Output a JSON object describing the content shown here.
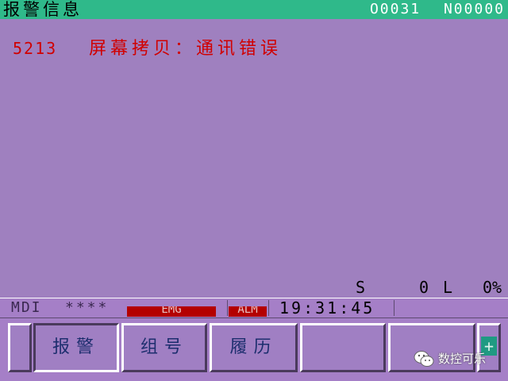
{
  "header": {
    "title": "报警信息",
    "program": "O0031",
    "sequence": "N00000"
  },
  "alarm": {
    "code": "5213",
    "message": "屏幕拷贝：通讯错误"
  },
  "spindle": {
    "s_label": "S",
    "s_value": "0",
    "l_label": "L",
    "l_value": "0%"
  },
  "status": {
    "mode": "MDI",
    "stars": "****",
    "emg": "EMG",
    "alm": "ALM",
    "time": "19:31:45"
  },
  "softkeys": {
    "k1": "报警",
    "k2": "组号",
    "k3": "履历",
    "k4": "",
    "k5": ""
  },
  "plus": "+",
  "watermark": "数控可乐",
  "colors": {
    "background": "#9f80bf",
    "header": "#2fb98a",
    "alarm_text": "#d00000",
    "emg": "#b40000"
  }
}
